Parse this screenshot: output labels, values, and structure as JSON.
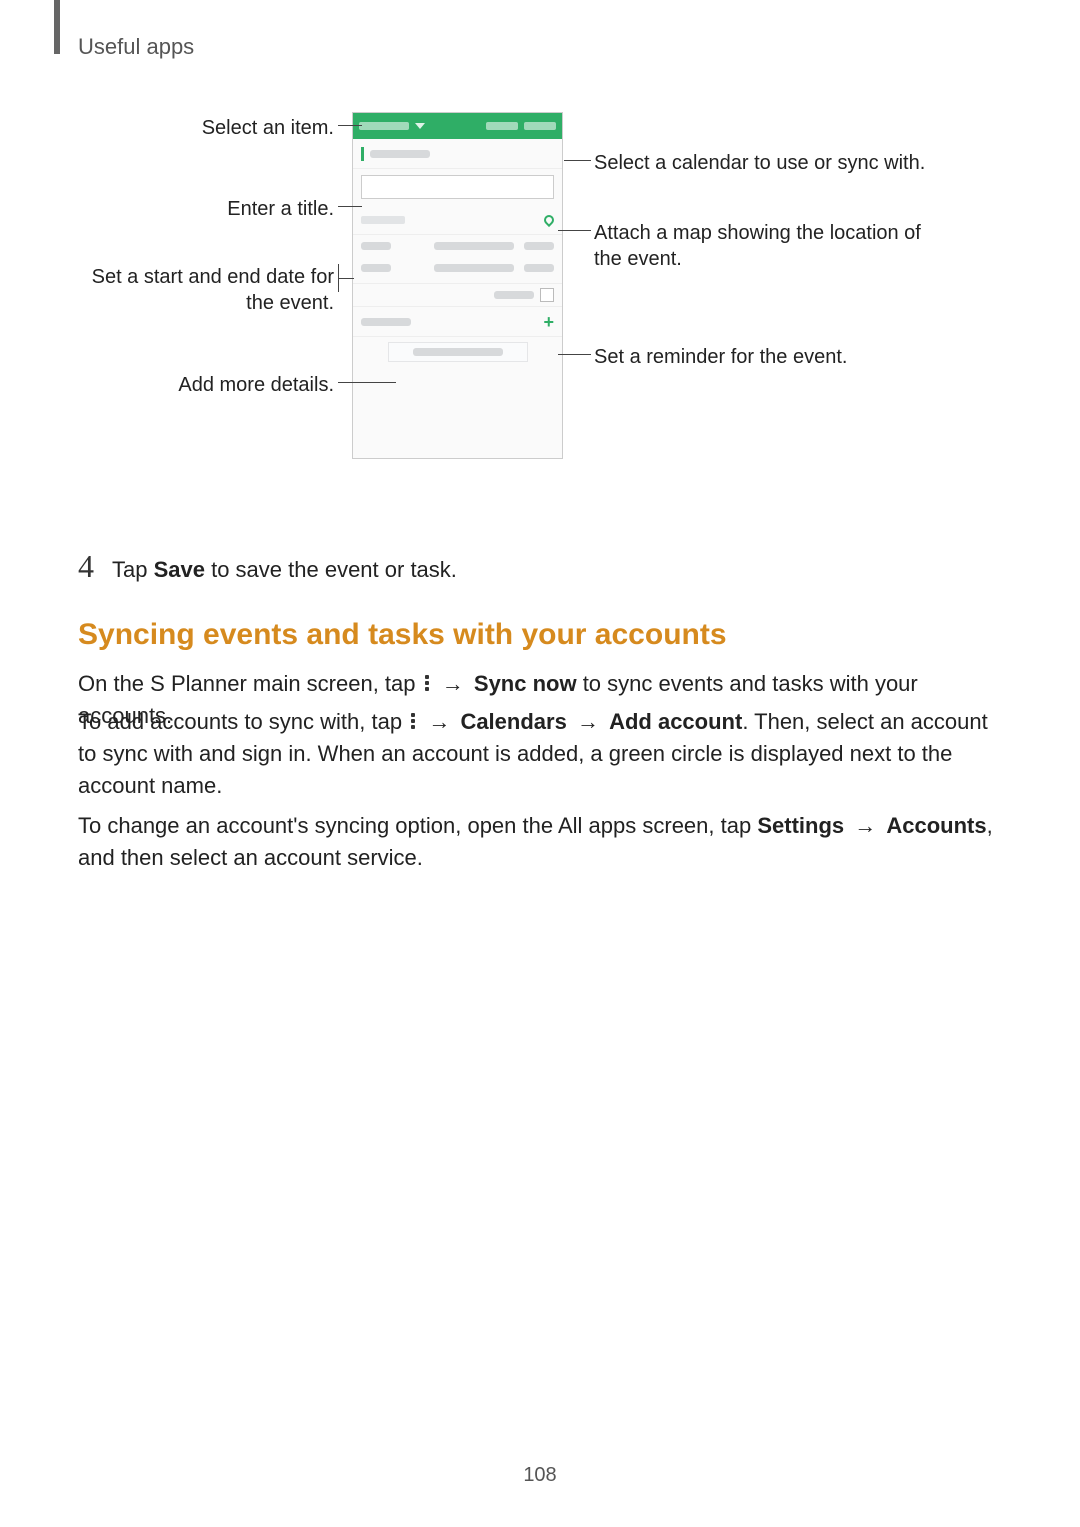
{
  "header": {
    "title": "Useful apps"
  },
  "callouts": {
    "left": {
      "select_item": "Select an item.",
      "enter_title": "Enter a title.",
      "set_dates": "Set a start and end date for the event.",
      "add_details": "Add more details."
    },
    "right": {
      "select_calendar": "Select a calendar to use or sync with.",
      "attach_map": "Attach a map showing the location of the event.",
      "set_reminder": "Set a reminder for the event."
    }
  },
  "step4": {
    "num": "4",
    "pre": "Tap ",
    "bold": "Save",
    "post": " to save the event or task."
  },
  "section_heading": "Syncing events and tasks with your accounts",
  "para1": {
    "pre": "On the S Planner main screen, tap ",
    "arrow1": "→",
    "b1": "Sync now",
    "post": " to sync events and tasks with your accounts."
  },
  "para2": {
    "pre": "To add accounts to sync with, tap ",
    "arrow1": "→",
    "b1": "Calendars",
    "arrow2": "→",
    "b2": "Add account",
    "post": ". Then, select an account to sync with and sign in. When an account is added, a green circle is displayed next to the account name."
  },
  "para3": {
    "pre": "To change an account's syncing option, open the All apps screen, tap ",
    "b1": "Settings",
    "arrow1": "→",
    "b2": "Accounts",
    "post": ", and then select an account service."
  },
  "page_number": "108"
}
